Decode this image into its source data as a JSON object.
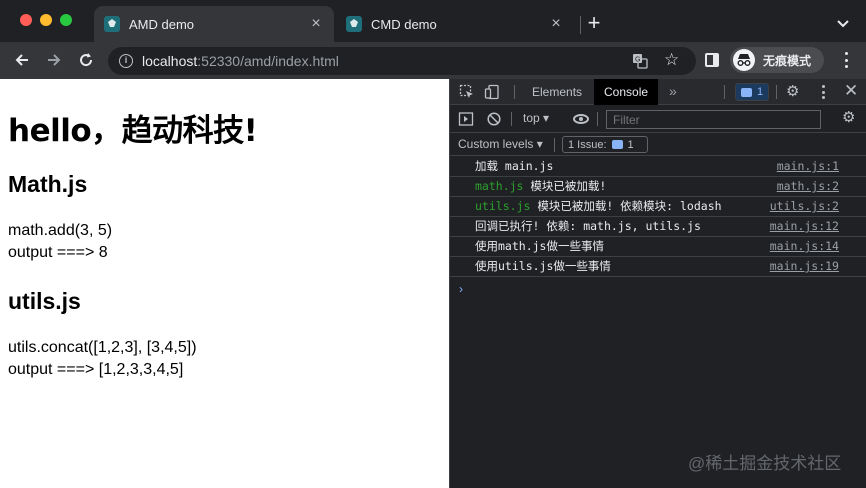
{
  "browser": {
    "tabs": [
      {
        "title": "AMD demo",
        "active": true
      },
      {
        "title": "CMD demo",
        "active": false
      }
    ],
    "new_tab": "+",
    "url_host": "localhost",
    "url_rest": ":52330/amd/index.html",
    "profile_label": "无痕模式"
  },
  "page": {
    "heading": "hello，趋动科技!",
    "math_title": "Math.js",
    "math_call": "math.add(3, 5)",
    "math_output": "output ===> 8",
    "utils_title": "utils.js",
    "utils_call": "utils.concat([1,2,3], [3,4,5])",
    "utils_output": "output ===> [1,2,3,3,4,5]"
  },
  "devtools": {
    "tabs": [
      "Elements",
      "Console"
    ],
    "active_tab": "Console",
    "message_count": "1",
    "context": "top ▾",
    "filter_placeholder": "Filter",
    "levels": "Custom levels ▾",
    "issues_label": "1 Issue:",
    "issues_count": "1",
    "logs": [
      {
        "prefix": "",
        "text": "加载 main.js",
        "source": "main.js:1"
      },
      {
        "prefix": "math.js",
        "text": " 模块已被加载!",
        "source": "math.js:2"
      },
      {
        "prefix": "utils.js",
        "text": " 模块已被加载! 依赖模块: lodash",
        "source": "utils.js:2"
      },
      {
        "prefix": "",
        "text": "回调已执行! 依赖: math.js, utils.js",
        "source": "main.js:12"
      },
      {
        "prefix": "",
        "text": "使用math.js做一些事情",
        "source": "main.js:14"
      },
      {
        "prefix": "",
        "text": "使用utils.js做一些事情",
        "source": "main.js:19"
      }
    ],
    "prompt": "›"
  },
  "watermark": "@稀土掘金技术社区",
  "colors": {
    "chrome_dark": "#202124",
    "toolbar": "#35363a",
    "accent_blue": "#8ab4f8",
    "log_green": "#2ca02c"
  }
}
